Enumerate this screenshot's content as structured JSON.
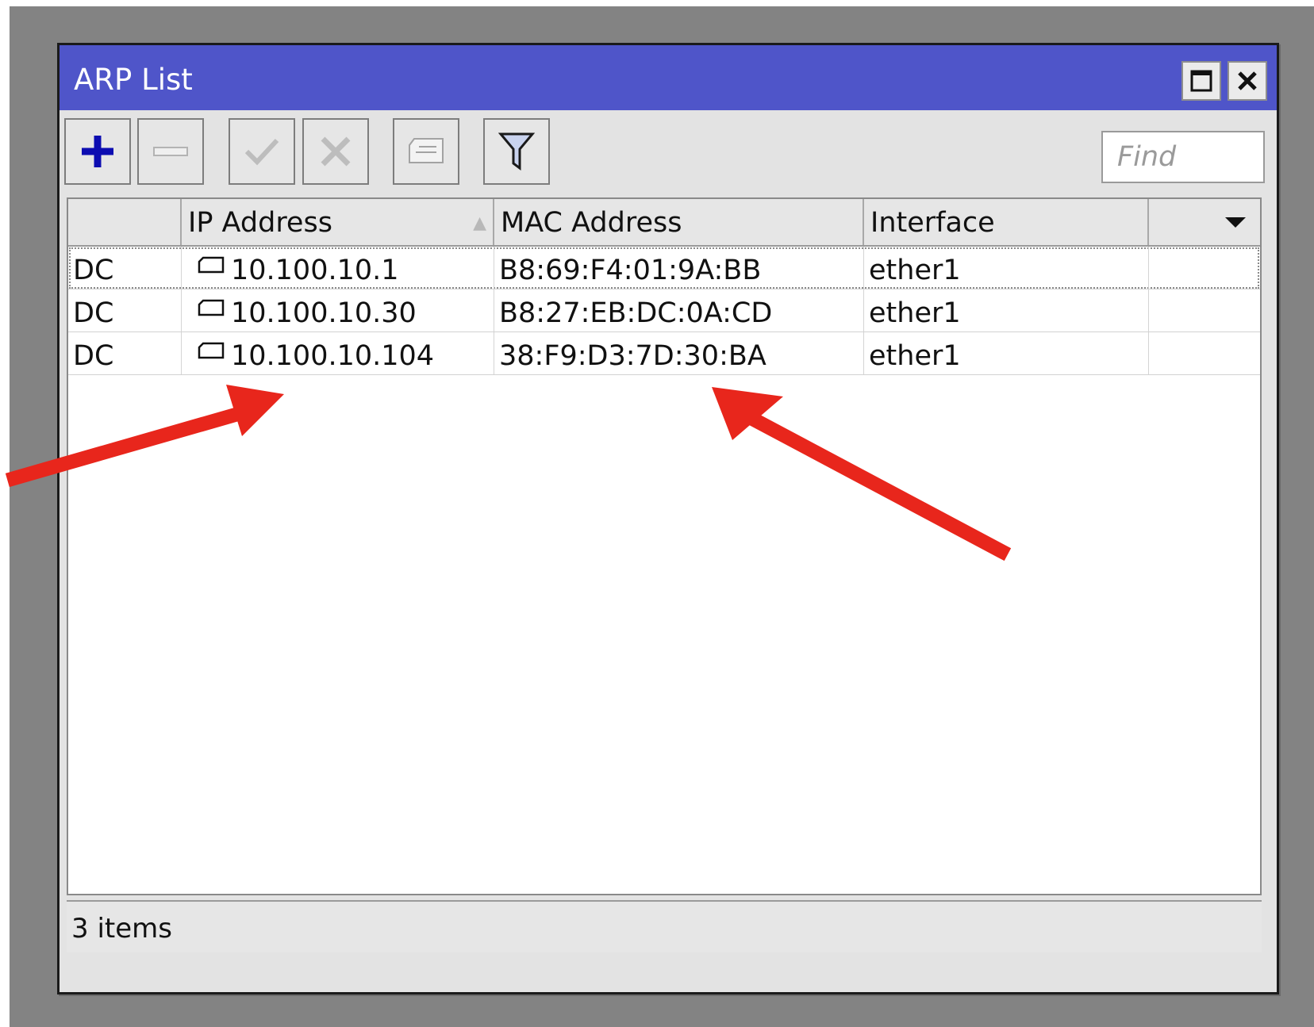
{
  "window": {
    "title": "ARP List",
    "title_bar_color": "#4f55c9",
    "controls": [
      "maximize-icon",
      "close-icon"
    ]
  },
  "toolbar": {
    "buttons": [
      {
        "name": "add",
        "icon": "plus-icon",
        "color": "#1010d0"
      },
      {
        "name": "remove",
        "icon": "minus-icon"
      },
      {
        "name": "enable",
        "icon": "check-icon"
      },
      {
        "name": "disable",
        "icon": "x-icon"
      },
      {
        "name": "comment",
        "icon": "comment-icon"
      },
      {
        "name": "filter",
        "icon": "funnel-icon"
      }
    ],
    "find_placeholder": "Find"
  },
  "table": {
    "columns": [
      "",
      "IP Address",
      "MAC Address",
      "Interface"
    ],
    "sorted_column": "IP Address",
    "rows": [
      {
        "flags": "DC",
        "ip": "10.100.10.1",
        "mac": "B8:69:F4:01:9A:BB",
        "interface": "ether1"
      },
      {
        "flags": "DC",
        "ip": "10.100.10.30",
        "mac": "B8:27:EB:DC:0A:CD",
        "interface": "ether1"
      },
      {
        "flags": "DC",
        "ip": "10.100.10.104",
        "mac": "38:F9:D3:7D:30:BA",
        "interface": "ether1"
      }
    ]
  },
  "status": {
    "text": "3 items"
  },
  "annotations": {
    "arrow_color": "#e8261c"
  }
}
